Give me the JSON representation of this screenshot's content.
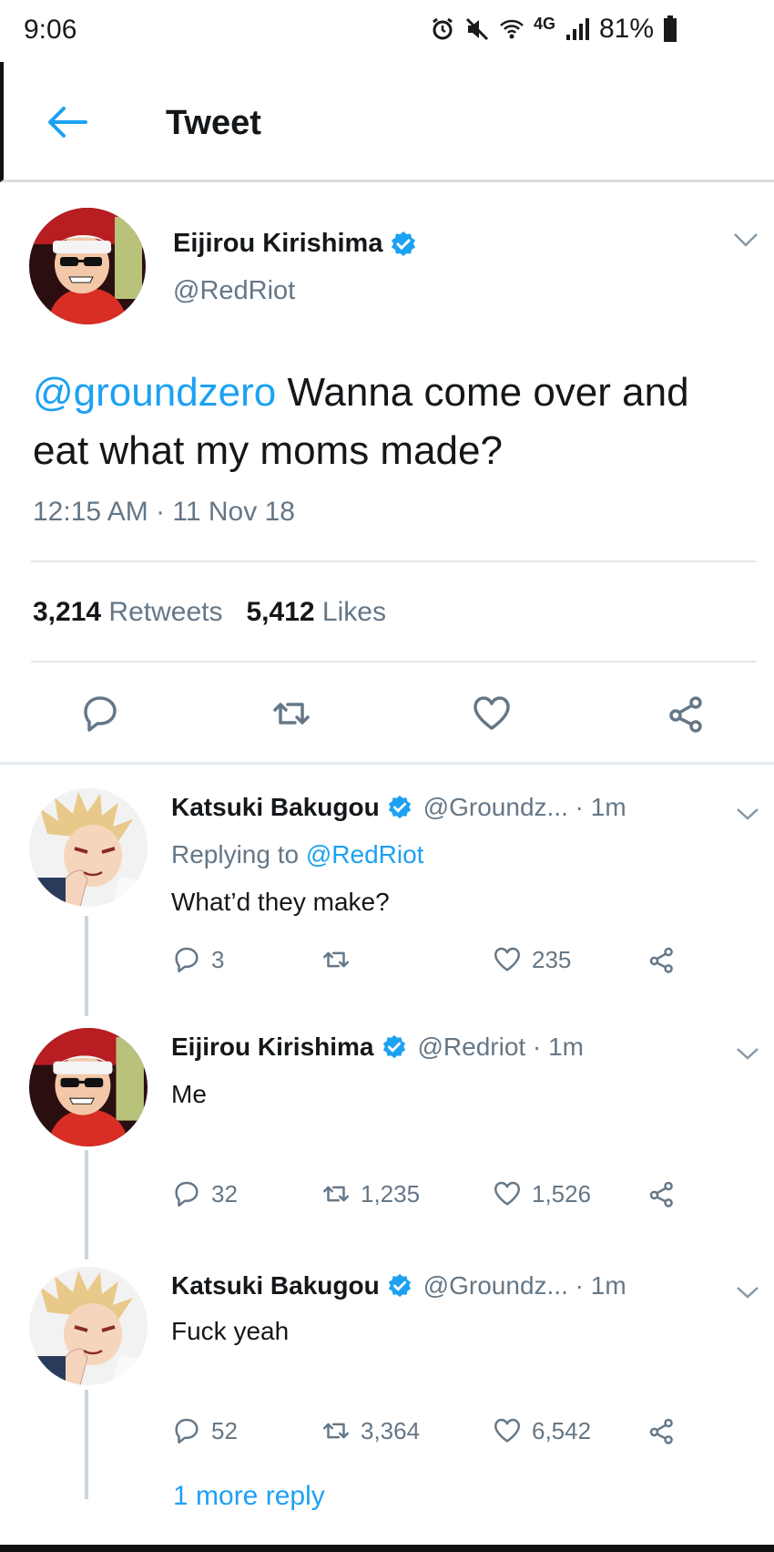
{
  "status_bar": {
    "time": "9:06",
    "battery": "81%",
    "network": "4G"
  },
  "header": {
    "title": "Tweet"
  },
  "main_tweet": {
    "name": "Eijirou Kirishima",
    "handle": "@RedRiot",
    "mention": "@groundzero",
    "text": " Wanna come over and eat what my moms made?",
    "timestamp": "12:15 AM · 11 Nov 18",
    "retweets_count": "3,214",
    "retweets_label": "Retweets",
    "likes_count": "5,412",
    "likes_label": "Likes"
  },
  "replies": [
    {
      "name": "Katsuki Bakugou",
      "handle": "@Groundz... · 1m",
      "replying_label": "Replying to ",
      "replying_to": "@RedRiot",
      "text": "What’d they make?",
      "reply_count": "3",
      "retweet_count": "",
      "like_count": "235"
    },
    {
      "name": "Eijirou Kirishima",
      "handle": "@Redriot · 1m",
      "text": "Me",
      "reply_count": "32",
      "retweet_count": "1,235",
      "like_count": "1,526"
    },
    {
      "name": "Katsuki Bakugou",
      "handle": "@Groundz... · 1m",
      "text": "Fuck yeah",
      "reply_count": "52",
      "retweet_count": "3,364",
      "like_count": "6,542"
    }
  ],
  "more_replies_link": "1 more reply",
  "colors": {
    "accent": "#1da1f2",
    "secondary_text": "#657786",
    "divider": "#e1e8ed"
  }
}
